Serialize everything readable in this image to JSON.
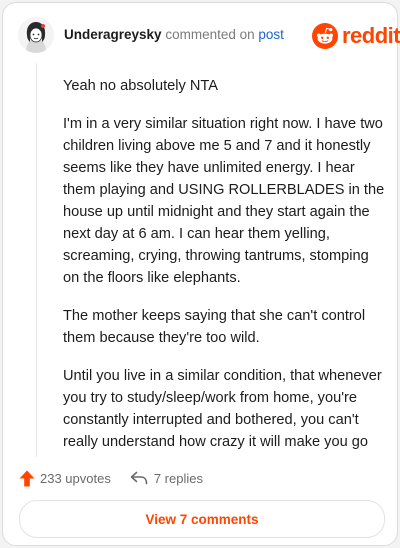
{
  "comment": {
    "username": "Underagreysky",
    "commented_on_text": "commented on",
    "post_link_text": "post",
    "paragraphs": [
      "Yeah no absolutely NTA",
      "I'm in a very similar situation right now. I have two children living above me 5 and 7 and it honestly seems like they have unlimited energy. I hear them playing and USING ROLLERBLADES in the house up until midnight and they start again the next day at 6 am. I can hear them yelling, screaming, crying, throwing tantrums, stomping on the floors like elephants.",
      "The mother keeps saying that she can't control them because they're too wild.",
      "Until you live in a similar condition, that whenever you try to study/sleep/work from home, you're constantly interrupted and bothered, you can't really understand how crazy it will make you go"
    ],
    "upvotes_text": "233 upvotes",
    "replies_text": "7 replies",
    "view_button_label": "View 7 comments"
  },
  "branding": {
    "logo_text": "reddit",
    "icon": "reddit-alien-icon",
    "accent_color": "#ff4500",
    "link_color": "#1a64d6"
  }
}
